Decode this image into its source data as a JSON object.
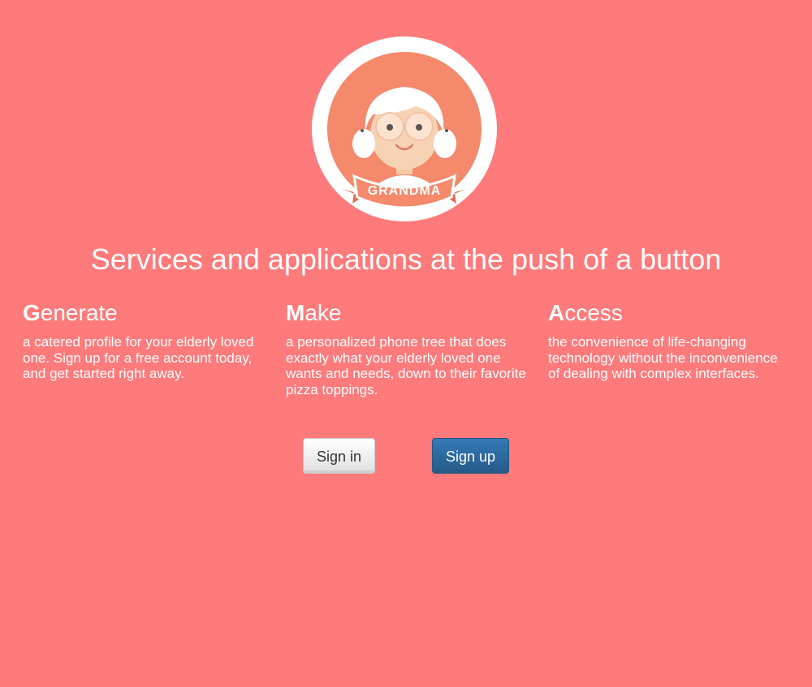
{
  "logo": {
    "banner_text": "GRANDMA",
    "icon": "grandma-avatar-icon"
  },
  "tagline": "Services and applications at the push of a button",
  "features": [
    {
      "initial": "G",
      "rest": "enerate",
      "description": "a catered profile for your elderly loved one. Sign up for a free account today, and get started right away."
    },
    {
      "initial": "M",
      "rest": "ake",
      "description": "a personalized phone tree that does exactly what your elderly loved one wants and needs, down to their favorite pizza toppings."
    },
    {
      "initial": "A",
      "rest": "ccess",
      "description": "the convenience of life-changing technology without the inconvenience of dealing with complex interfaces."
    }
  ],
  "buttons": {
    "signin_label": "Sign in",
    "signup_label": "Sign up"
  },
  "colors": {
    "background": "#ff7a7b",
    "logo_disc": "#f4896b",
    "signup_button": "#2d6da3"
  }
}
